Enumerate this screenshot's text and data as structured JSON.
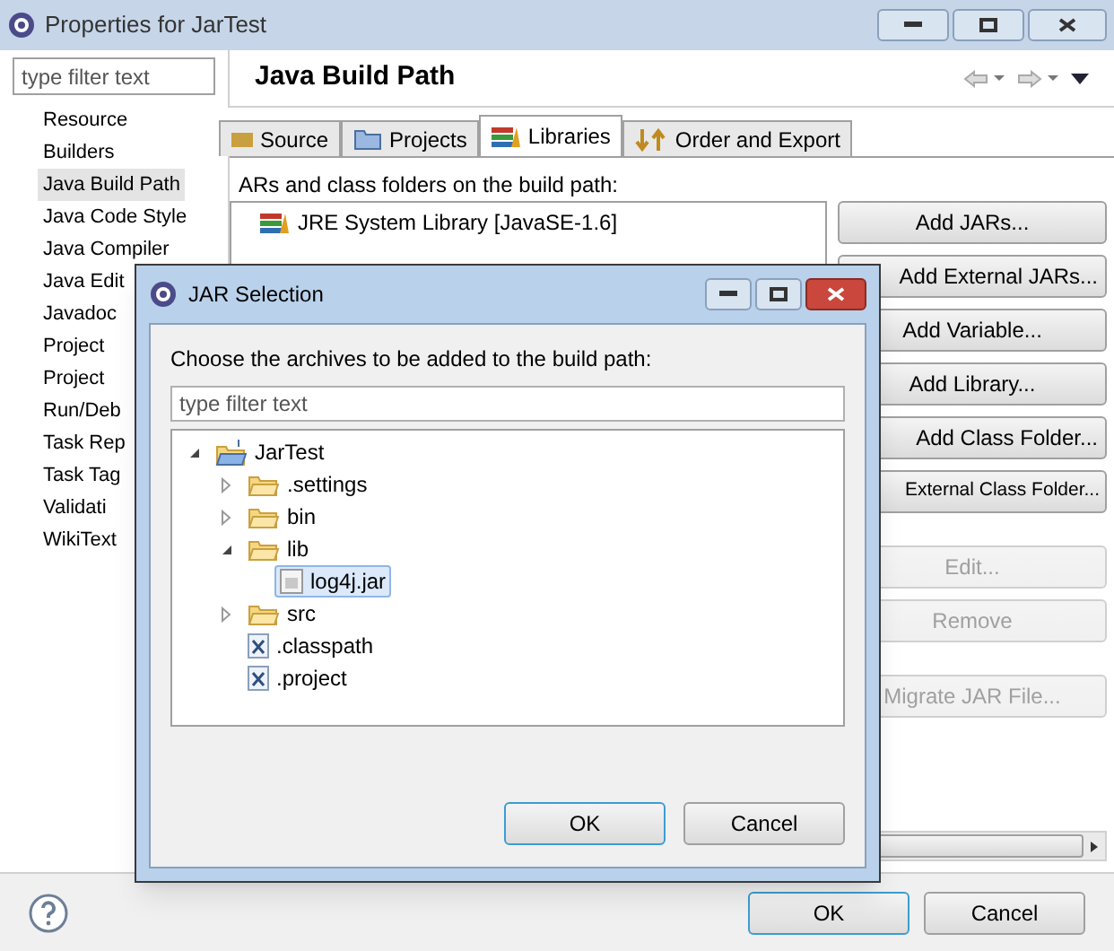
{
  "window": {
    "title": "Properties for JarTest"
  },
  "sidebar": {
    "filter": {
      "placeholder": "type filter text"
    },
    "items": [
      {
        "label": "Resource",
        "selected": false
      },
      {
        "label": "Builders",
        "selected": false
      },
      {
        "label": "Java Build Path",
        "selected": true
      },
      {
        "label": "Java Code Style",
        "selected": false
      },
      {
        "label": "Java Compiler",
        "selected": false
      },
      {
        "label": "Java Edit",
        "selected": false
      },
      {
        "label": "Javadoc",
        "selected": false
      },
      {
        "label": "Project",
        "selected": false
      },
      {
        "label": "Project",
        "selected": false
      },
      {
        "label": "Run/Deb",
        "selected": false
      },
      {
        "label": "Task Rep",
        "selected": false
      },
      {
        "label": "Task Tag",
        "selected": false
      },
      {
        "label": "Validati",
        "selected": false
      },
      {
        "label": "WikiText",
        "selected": false
      }
    ]
  },
  "page": {
    "title": "Java Build Path",
    "tabs": [
      {
        "label": "Source",
        "selected": false,
        "kind": "source"
      },
      {
        "label": "Projects",
        "selected": false,
        "kind": "projects"
      },
      {
        "label": "Libraries",
        "selected": true,
        "kind": "libraries"
      },
      {
        "label": "Order and Export",
        "selected": false,
        "kind": "order"
      }
    ],
    "list_label": "ARs and class folders on the build path:",
    "libraries": [
      {
        "label": "JRE System Library [JavaSE-1.6]"
      }
    ],
    "buttons": [
      {
        "label": "Add JARs...",
        "disabled": false
      },
      {
        "label": "Add External JARs...",
        "disabled": false
      },
      {
        "label": "Add Variable...",
        "disabled": false
      },
      {
        "label": "Add Library...",
        "disabled": false
      },
      {
        "label": "Add Class Folder...",
        "disabled": false
      },
      {
        "label": "External Class Folder...",
        "disabled": false
      },
      {
        "label": "Edit...",
        "disabled": true
      },
      {
        "label": "Remove",
        "disabled": true
      },
      {
        "label": "Migrate JAR File...",
        "disabled": true
      }
    ]
  },
  "dialog": {
    "title": "JAR Selection",
    "prompt": "Choose the archives to be added to the build path:",
    "filter": {
      "placeholder": "type filter text"
    },
    "tree": [
      {
        "label": "JarTest",
        "kind": "project",
        "expanded": true,
        "selected": false,
        "children": [
          {
            "label": ".settings",
            "kind": "folder",
            "expanded": false,
            "selected": false
          },
          {
            "label": "bin",
            "kind": "folder",
            "expanded": false,
            "selected": false
          },
          {
            "label": "lib",
            "kind": "folder",
            "expanded": true,
            "selected": false,
            "children": [
              {
                "label": "log4j.jar",
                "kind": "jar",
                "selected": true
              }
            ]
          },
          {
            "label": "src",
            "kind": "folder",
            "expanded": false,
            "selected": false
          },
          {
            "label": ".classpath",
            "kind": "file",
            "selected": false
          },
          {
            "label": ".project",
            "kind": "file",
            "selected": false
          }
        ]
      }
    ],
    "buttons": [
      {
        "label": "OK",
        "default": true
      },
      {
        "label": "Cancel",
        "default": false
      }
    ]
  },
  "footer": {
    "buttons": [
      {
        "label": "OK",
        "default": true
      },
      {
        "label": "Cancel",
        "default": false
      }
    ]
  }
}
